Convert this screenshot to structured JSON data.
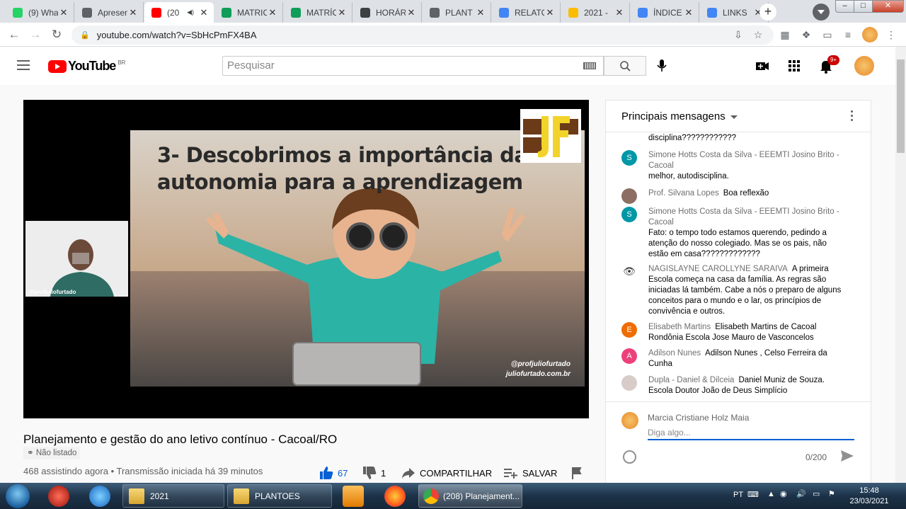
{
  "tabs": [
    {
      "label": "(9) Wha",
      "icon": "whatsapp-icon",
      "color": "#25d366",
      "active": false
    },
    {
      "label": "Apresen",
      "icon": "globe-icon",
      "color": "#5f6368",
      "active": false
    },
    {
      "label": "(20",
      "icon": "youtube-icon",
      "color": "#ff0000",
      "active": true
    },
    {
      "label": "MATRIC",
      "icon": "sheets-icon",
      "color": "#0f9d58",
      "active": false
    },
    {
      "label": "MATRÍC",
      "icon": "sheets-icon",
      "color": "#0f9d58",
      "active": false
    },
    {
      "label": "HORÁR",
      "icon": "classroom-icon",
      "color": "#3c4043",
      "active": false
    },
    {
      "label": "PLANT",
      "icon": "globe-icon",
      "color": "#5f6368",
      "active": false
    },
    {
      "label": "RELATO",
      "icon": "docs-icon",
      "color": "#4285f4",
      "active": false
    },
    {
      "label": "2021 -",
      "icon": "drive-icon",
      "color": "#fbbc04",
      "active": false
    },
    {
      "label": "ÍNDICE",
      "icon": "docs-icon",
      "color": "#4285f4",
      "active": false
    },
    {
      "label": "LINKS",
      "icon": "docs-icon",
      "color": "#4285f4",
      "active": false
    }
  ],
  "browser": {
    "url": "youtube.com/watch?v=SbHcPmFX4BA"
  },
  "youtube": {
    "logo_text": "YouTube",
    "country": "BR",
    "search_placeholder": "Pesquisar",
    "notif_count": "9+"
  },
  "video": {
    "slide_title": "3- Descobrimos a importância da autonomia para a aprendizagem",
    "watermark1": "@profjuliofurtado",
    "watermark2": "juliofurtado.com.br",
    "webcam_label": "@profjuliofurtado",
    "title": "Planejamento e gestão do ano letivo contínuo - Cacoal/RO",
    "unlisted": "Não listado",
    "view_info": "468 assistindo agora • Transmissão iniciada há 39 minutos",
    "likes": "67",
    "dislikes": "1",
    "share_label": "COMPARTILHAR",
    "save_label": "SALVAR"
  },
  "chat": {
    "title": "Principais mensagens",
    "messages": [
      {
        "author": "",
        "text": "disciplina????????????",
        "initial": "",
        "color": ""
      },
      {
        "author": "Simone Hotts Costa da Silva - EEEMTI Josino Brito - Cacoal",
        "text": "melhor, autodisciplina.",
        "initial": "S",
        "color": "#0097a7"
      },
      {
        "author": "Prof. Silvana Lopes",
        "text": "Boa reflexão",
        "initial": "",
        "color": "#8d6e63"
      },
      {
        "author": "Simone Hotts Costa da Silva - EEEMTI Josino Brito - Cacoal",
        "text": "Fato: o tempo todo estamos querendo, pedindo a atenção do nosso colegiado. Mas se os pais, não estão em casa?????????????",
        "initial": "S",
        "color": "#0097a7"
      },
      {
        "author": "NAGISLAYNE CAROLLYNE SARAIVA",
        "text": "A primeira Escola começa na casa da família. As regras são iniciadas lá também. Cabe a nós o preparo de alguns conceitos para o mundo e o lar, os princípios de convivência e outros.",
        "initial": "",
        "color": "#ffffff"
      },
      {
        "author": "Elisabeth Martins",
        "text": "Elisabeth Martins de Cacoal Rondônia Escola Jose Mauro de Vasconcelos",
        "initial": "E",
        "color": "#ef6c00"
      },
      {
        "author": "Adilson Nunes",
        "text": "Adilson Nunes , Celso Ferreira da Cunha",
        "initial": "A",
        "color": "#ec407a"
      },
      {
        "author": "Dupla - Daniel & Dilceia",
        "text": "Daniel Muniz de Souza. Escola Doutor João de Deus Simplício",
        "initial": "",
        "color": "#d7ccc8"
      }
    ],
    "me_name": "Marcia Cristiane Holz Maia",
    "input_placeholder": "Diga algo...",
    "counter": "0/200"
  },
  "taskbar": {
    "items": [
      {
        "label": "2021"
      },
      {
        "label": "PLANTOES"
      },
      {
        "label": "(208) Planejament..."
      }
    ],
    "lang": "PT",
    "time": "15:48",
    "date": "23/03/2021"
  }
}
